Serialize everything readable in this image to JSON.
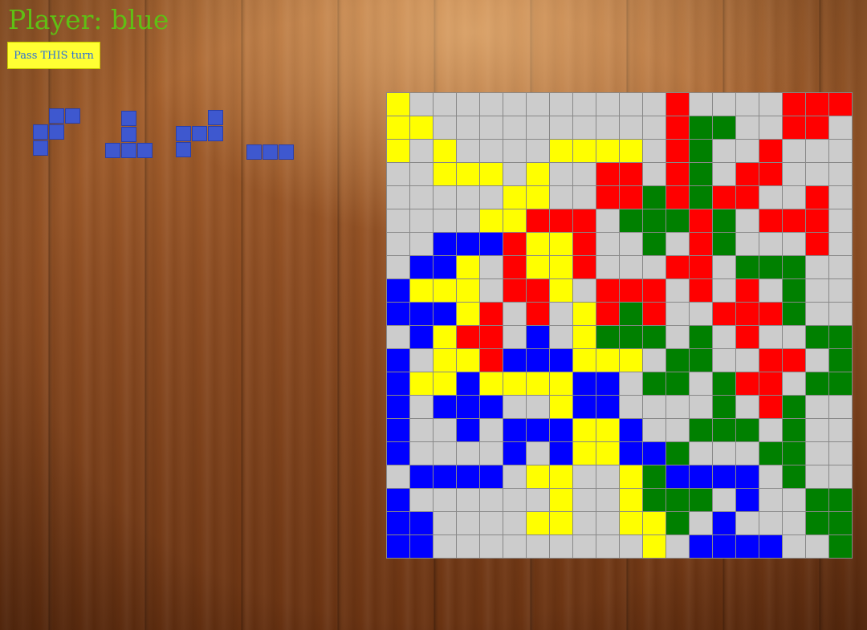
{
  "header": {
    "player_label": "Player: blue"
  },
  "controls": {
    "pass_label": "Pass THIS turn"
  },
  "colors": {
    "empty": "#cccccc",
    "yellow": "#ffff00",
    "red": "#ff0000",
    "green": "#008000",
    "blue": "#0000ff",
    "title": "#5fbf14",
    "button": "#ffff33",
    "button_text": "#2a70d8",
    "piece": "#3e58cf"
  },
  "pieces": [
    {
      "name": "z-pentomino",
      "cells": [
        [
          0,
          1
        ],
        [
          0,
          2
        ],
        [
          1,
          0
        ],
        [
          1,
          1
        ],
        [
          2,
          0
        ]
      ]
    },
    {
      "name": "t-tetromino",
      "cells": [
        [
          0,
          1
        ],
        [
          1,
          1
        ],
        [
          2,
          0
        ],
        [
          2,
          1
        ],
        [
          2,
          2
        ]
      ]
    },
    {
      "name": "s-tetromino",
      "cells": [
        [
          0,
          2
        ],
        [
          1,
          0
        ],
        [
          1,
          1
        ],
        [
          1,
          2
        ],
        [
          2,
          0
        ]
      ]
    },
    {
      "name": "i3-tromino",
      "cells": [
        [
          0,
          0
        ],
        [
          0,
          1
        ],
        [
          0,
          2
        ]
      ]
    }
  ],
  "board": {
    "size": 20,
    "rows": [
      "YNNNNNNNNNNNRNNNNRRR",
      "YYNNNNNNNNNNRGGNNRRN",
      "YNYNNNNYYYYNRGNNRNNN",
      "NNYYYNYNNRRNRGNRRNNN",
      "NNNNNYYNNRRGRGRRNNRN",
      "NNNNYYRRRNGGGRGNRRRN",
      "NNBBBRYYRNNGNRGNNNRN",
      "NBBYNRYYRNNNRRNGGGNN",
      "BYYYNRRYNRRRNRNRNGNN",
      "BBBYRNRNYRGRNNRRRGNN",
      "NBYRRNBNYGGGNGNRNNGG",
      "BNYYRBBBYYYNGGNNRRNG",
      "BYYBYYYYBBNGGNGRRNGG",
      "BNBBBNNYBBNNNNGNRGNN",
      "BNNBNBBBYYBNNGGGNGNN",
      "BNNNNBNBYYBBGNNNGGNN",
      "NBBBBNYYNNYGBBBBNGNN",
      "BNNNNNNYNNYGGGNBNNGG",
      "BBNNNNYYNNYYGNBNNNGG",
      "BBNNNNNNNNNYNBBBBNNG"
    ]
  }
}
